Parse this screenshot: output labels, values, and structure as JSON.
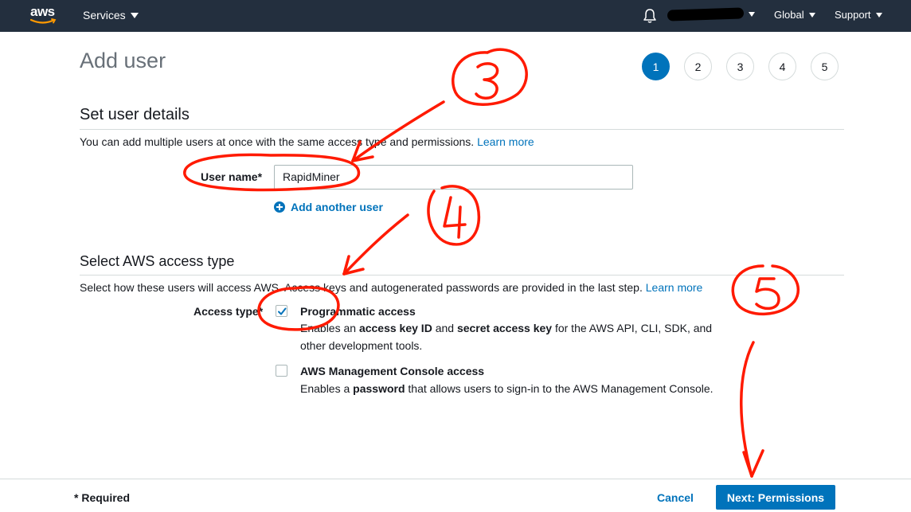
{
  "nav": {
    "logo": "aws",
    "services": "Services",
    "global": "Global",
    "support": "Support",
    "icons": {
      "bell": "bell-icon",
      "caret": "caret-down-icon"
    }
  },
  "header": {
    "title": "Add user",
    "steps": [
      "1",
      "2",
      "3",
      "4",
      "5"
    ],
    "active_step": "1"
  },
  "user_details": {
    "title": "Set user details",
    "desc_prefix": "You can add multiple users at once with the same access type and permissions. ",
    "learn_more": "Learn more",
    "username_label": "User name*",
    "username_value": "RapidMiner",
    "add_another": "Add another user"
  },
  "access_type": {
    "title": "Select AWS access type",
    "desc_prefix": "Select how these users will access AWS. Access keys and autogenerated passwords are provided in the last step. ",
    "learn_more": "Learn more",
    "label": "Access type*",
    "programmatic": {
      "title": "Programmatic access",
      "d1": "Enables an ",
      "b1": "access key ID",
      "d2": " and ",
      "b2": "secret access key",
      "d3": " for the AWS API, CLI, SDK, and other development tools.",
      "checked": true
    },
    "console": {
      "title": "AWS Management Console access",
      "d1": "Enables a ",
      "b1": "password",
      "d2": " that allows users to sign-in to the AWS Management Console.",
      "checked": false
    }
  },
  "footer": {
    "required": "* Required",
    "cancel": "Cancel",
    "next": "Next: Permissions"
  },
  "annotations": [
    "3",
    "4",
    "5"
  ],
  "colors": {
    "nav_bg": "#232f3e",
    "primary": "#0073bb",
    "annotation": "#ff0000"
  }
}
